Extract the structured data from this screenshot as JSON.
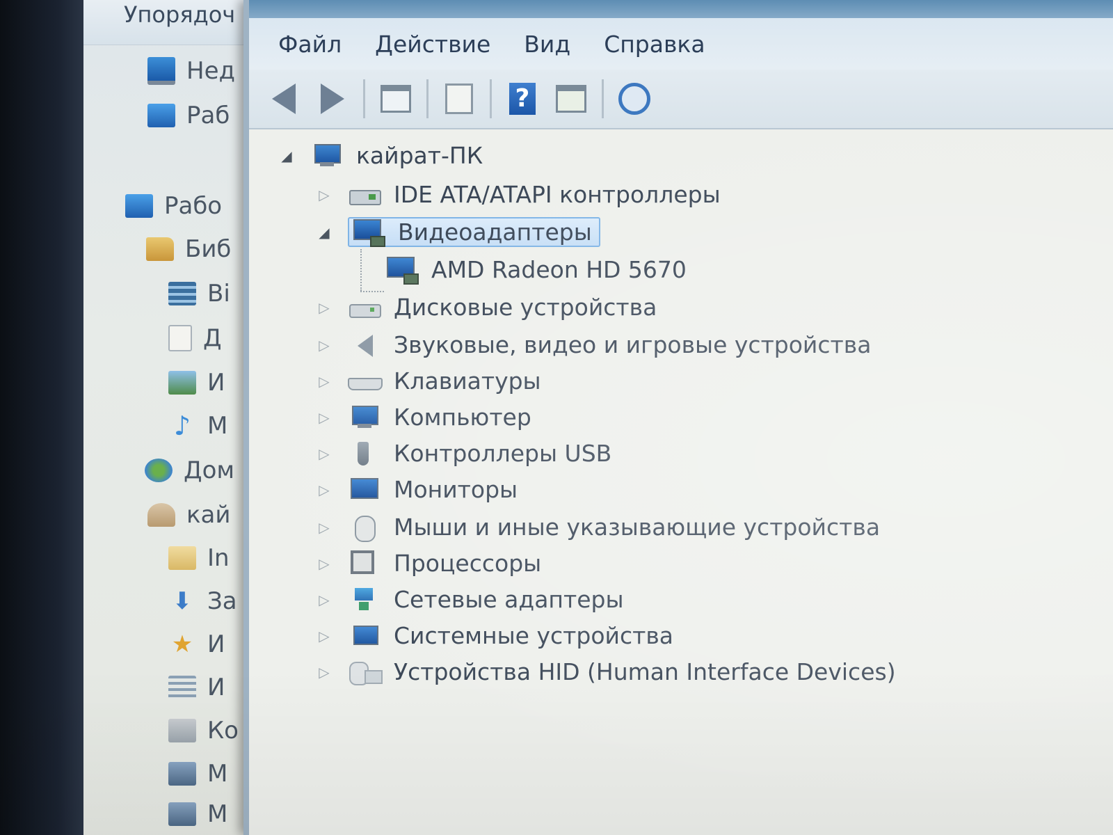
{
  "background_explorer": {
    "toolbar_label": "Упорядоч",
    "items": [
      {
        "label": "Нед",
        "icon": "computer-icon"
      },
      {
        "label": "Раб",
        "icon": "desktop-icon"
      },
      {
        "label": "Рабо",
        "icon": "desktop-icon"
      },
      {
        "label": "Биб",
        "icon": "library-icon"
      },
      {
        "label": "Ві",
        "icon": "video-icon"
      },
      {
        "label": "Д",
        "icon": "document-icon"
      },
      {
        "label": "И",
        "icon": "image-icon"
      },
      {
        "label": "М",
        "icon": "music-icon"
      },
      {
        "label": "Дом",
        "icon": "homegroup-icon"
      },
      {
        "label": "кай",
        "icon": "user-icon"
      },
      {
        "label": "In",
        "icon": "folder-icon"
      },
      {
        "label": "За",
        "icon": "download-icon"
      },
      {
        "label": "И",
        "icon": "favorites-icon"
      },
      {
        "label": "И",
        "icon": "list-icon"
      },
      {
        "label": "Ко",
        "icon": "contacts-icon"
      },
      {
        "label": "М",
        "icon": "music-folder-icon"
      },
      {
        "label": "М",
        "icon": "music-folder-icon"
      }
    ]
  },
  "menu": {
    "file": "Файл",
    "action": "Действие",
    "view": "Вид",
    "help": "Справка"
  },
  "toolbar": {
    "help_glyph": "?"
  },
  "tree": {
    "root": "кайрат-ПК",
    "categories": [
      {
        "label": "IDE ATA/ATAPI контроллеры",
        "icon": "ide-controller-icon",
        "expanded": false
      },
      {
        "label": "Видеоадаптеры",
        "icon": "display-adapter-icon",
        "expanded": true,
        "selected": true,
        "children": [
          {
            "label": "AMD Radeon HD 5670",
            "icon": "display-adapter-icon"
          }
        ]
      },
      {
        "label": "Дисковые устройства",
        "icon": "disk-drive-icon",
        "expanded": false
      },
      {
        "label": "Звуковые, видео и игровые устройства",
        "icon": "speaker-icon",
        "expanded": false
      },
      {
        "label": "Клавиатуры",
        "icon": "keyboard-icon",
        "expanded": false
      },
      {
        "label": "Компьютер",
        "icon": "computer-icon",
        "expanded": false
      },
      {
        "label": "Контроллеры USB",
        "icon": "usb-icon",
        "expanded": false
      },
      {
        "label": "Мониторы",
        "icon": "monitor-icon",
        "expanded": false
      },
      {
        "label": "Мыши и иные указывающие устройства",
        "icon": "mouse-icon",
        "expanded": false
      },
      {
        "label": "Процессоры",
        "icon": "processor-icon",
        "expanded": false
      },
      {
        "label": "Сетевые адаптеры",
        "icon": "network-adapter-icon",
        "expanded": false
      },
      {
        "label": "Системные устройства",
        "icon": "system-device-icon",
        "expanded": false
      },
      {
        "label": "Устройства HID (Human Interface Devices)",
        "icon": "hid-icon",
        "expanded": false
      }
    ]
  }
}
